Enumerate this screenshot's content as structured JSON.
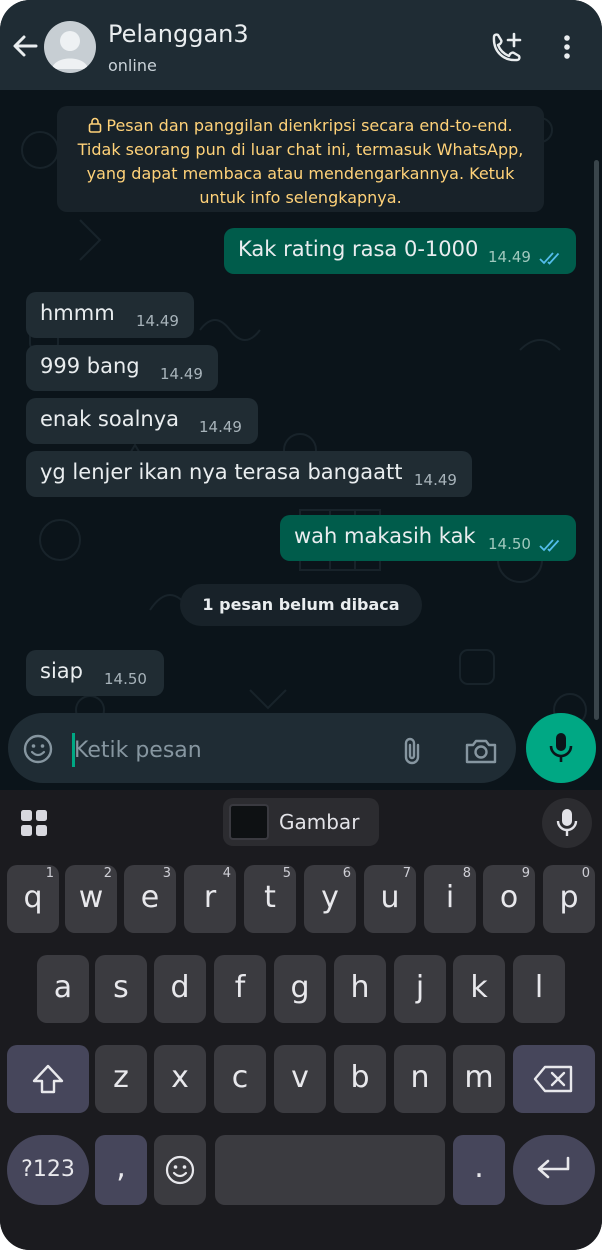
{
  "header": {
    "contact_name": "Pelanggan3",
    "status": "online"
  },
  "encryption_notice": "Pesan dan panggilan dienkripsi secara end-to-end. Tidak seorang pun di luar chat ini, termasuk WhatsApp, yang dapat membaca atau mendengarkannya. Ketuk untuk info selengkapnya.",
  "messages": [
    {
      "dir": "out",
      "text": "Kak rating rasa 0-1000",
      "time": "14.49"
    },
    {
      "dir": "in",
      "text": "hmmm",
      "time": "14.49"
    },
    {
      "dir": "in",
      "text": "999 bang",
      "time": "14.49"
    },
    {
      "dir": "in",
      "text": "enak soalnya",
      "time": "14.49"
    },
    {
      "dir": "in",
      "text": "yg lenjer ikan nya terasa bangaatt",
      "time": "14.49"
    },
    {
      "dir": "out",
      "text": "wah makasih kak",
      "time": "14.50"
    },
    {
      "dir": "in",
      "text": "siap",
      "time": "14.50"
    }
  ],
  "unread_label": "1 pesan belum dibaca",
  "composer": {
    "placeholder": "Ketik pesan"
  },
  "keyboard": {
    "suggestion_chip": "Gambar",
    "row1": [
      {
        "k": "q",
        "h": "1"
      },
      {
        "k": "w",
        "h": "2"
      },
      {
        "k": "e",
        "h": "3"
      },
      {
        "k": "r",
        "h": "4"
      },
      {
        "k": "t",
        "h": "5"
      },
      {
        "k": "y",
        "h": "6"
      },
      {
        "k": "u",
        "h": "7"
      },
      {
        "k": "i",
        "h": "8"
      },
      {
        "k": "o",
        "h": "9"
      },
      {
        "k": "p",
        "h": "0"
      }
    ],
    "row2": [
      "a",
      "s",
      "d",
      "f",
      "g",
      "h",
      "j",
      "k",
      "l"
    ],
    "row3": [
      "z",
      "x",
      "c",
      "v",
      "b",
      "n",
      "m"
    ],
    "sym_key": "?123",
    "comma_key": ",",
    "period_key": "."
  },
  "colors": {
    "incoming_bubble": "#202c33",
    "outgoing_bubble": "#005c4b",
    "accent": "#00a884",
    "notice_text": "#ffd279"
  }
}
